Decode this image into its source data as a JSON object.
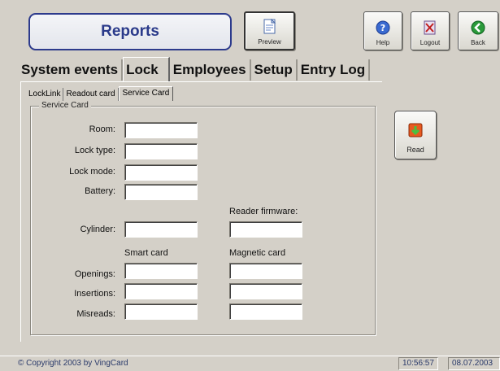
{
  "header": {
    "title": "Reports",
    "toolbar": {
      "preview_label": "Preview",
      "help_label": "Help",
      "logout_label": "Logout",
      "back_label": "Back"
    }
  },
  "main_tabs": [
    {
      "label": "System events"
    },
    {
      "label": "Lock",
      "active": true
    },
    {
      "label": "Employees"
    },
    {
      "label": "Setup"
    },
    {
      "label": "Entry Log"
    }
  ],
  "sub_tabs": [
    {
      "label": "LockLink"
    },
    {
      "label": "Readout card"
    },
    {
      "label": "Service Card",
      "active": true
    }
  ],
  "service_card": {
    "group_title": "Service Card",
    "fields": {
      "room_label": "Room:",
      "lock_type_label": "Lock type:",
      "lock_mode_label": "Lock mode:",
      "battery_label": "Battery:",
      "cylinder_label": "Cylinder:",
      "reader_firmware_label": "Reader firmware:",
      "smart_card_header": "Smart card",
      "magnetic_card_header": "Magnetic card",
      "openings_label": "Openings:",
      "insertions_label": "Insertions:",
      "misreads_label": "Misreads:"
    },
    "values": {
      "room": "",
      "lock_type": "",
      "lock_mode": "",
      "battery": "",
      "cylinder": "",
      "reader_firmware": "",
      "openings_smart": "",
      "openings_magnetic": "",
      "insertions_smart": "",
      "insertions_magnetic": "",
      "misreads_smart": "",
      "misreads_magnetic": ""
    },
    "read_label": "Read"
  },
  "status": {
    "copyright": "© Copyright 2003 by VingCard",
    "time": "10:56:57",
    "date": "08.07.2003"
  },
  "colors": {
    "background": "#d4d0c8",
    "title_text": "#2a3a8a",
    "title_border": "#2c3a8c"
  }
}
